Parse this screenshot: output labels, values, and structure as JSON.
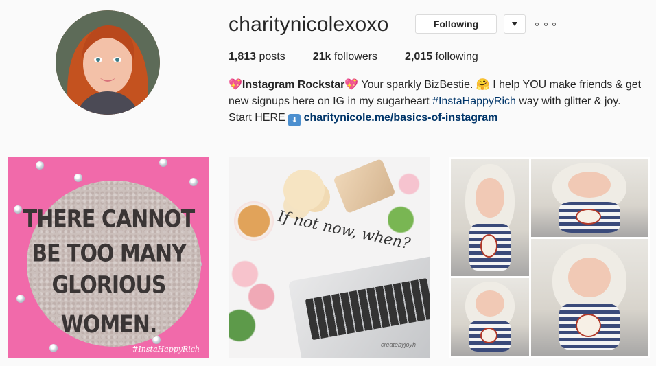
{
  "profile": {
    "username": "charitynicolexoxo",
    "follow_button": "Following",
    "posts_count": "1,813",
    "posts_label": "posts",
    "followers_count": "21k",
    "followers_label": "followers",
    "following_count": "2,015",
    "following_label": "following"
  },
  "bio": {
    "heart_emoji": "💖",
    "name": "Instagram Rockstar",
    "text1": " Your sparkly BizBestie. ",
    "hug_emoji": "🤗",
    "text2": " I help YOU make friends & get new signups here on IG in my sugarheart ",
    "hashtag": "#InstaHappyRich",
    "text3": " way with glitter & joy. Start HERE ",
    "down_emoji": "⬇",
    "link": "charitynicole.me/basics-of-instagram"
  },
  "posts": [
    {
      "quote_lines": [
        "THERE CANNOT",
        "BE TOO MANY",
        "GLORIOUS WOMEN."
      ],
      "watermark": "#InstaHappyRich"
    },
    {
      "script_text": "If not now, when?",
      "signature": "createbyjoyh"
    },
    {
      "type": "collage"
    }
  ]
}
